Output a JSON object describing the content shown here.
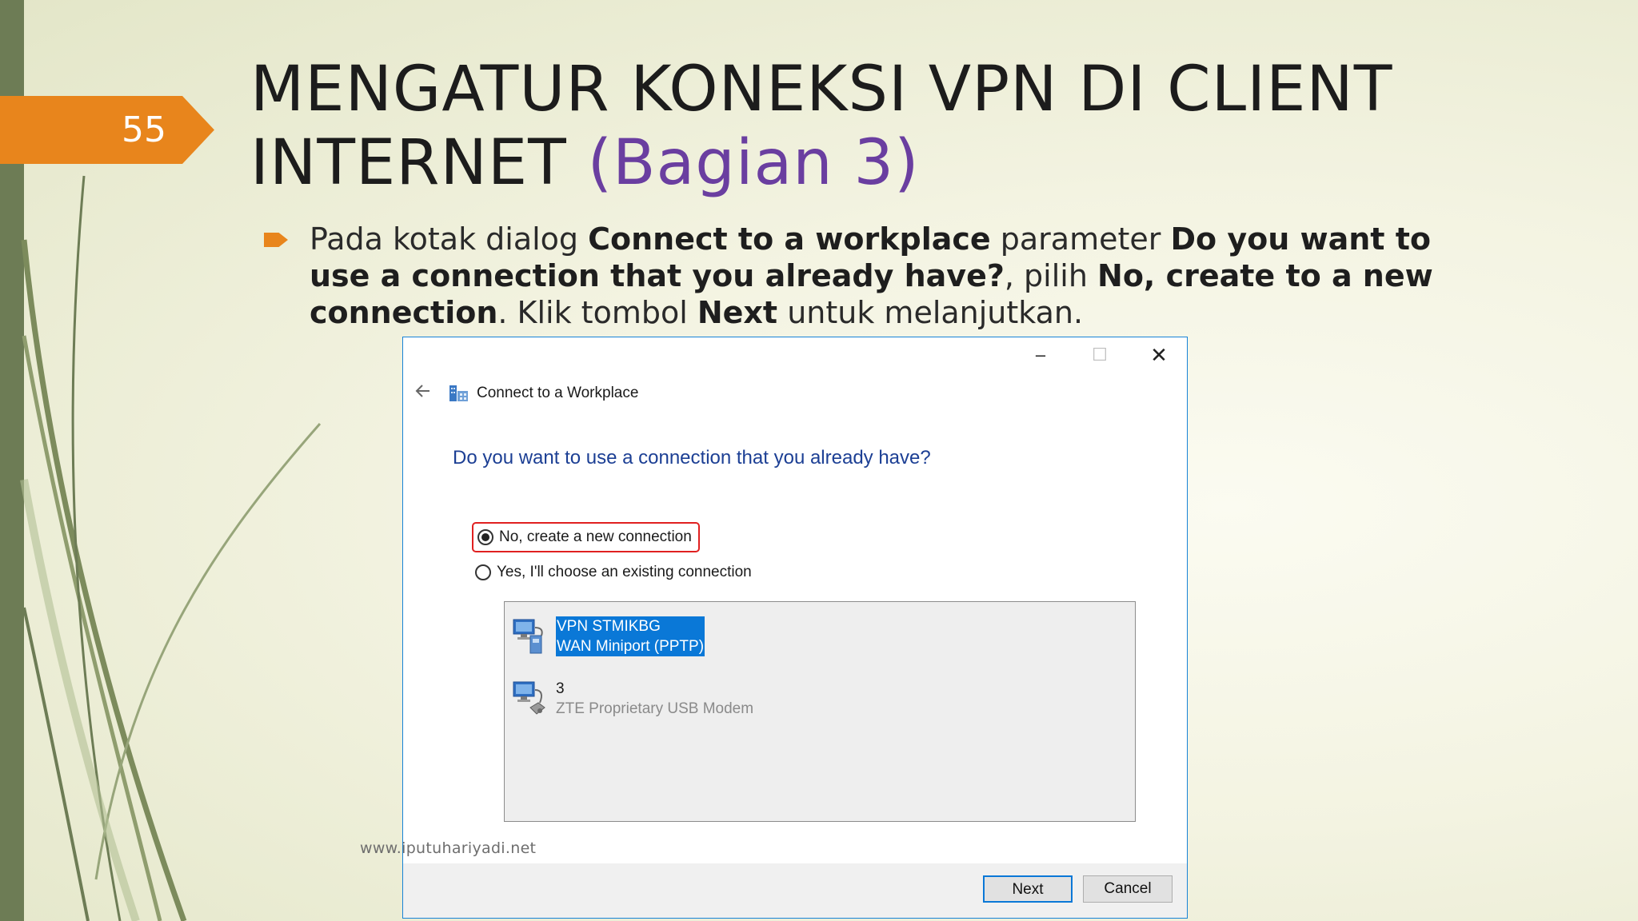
{
  "slide": {
    "page_number": "55",
    "title_main": "MENGATUR KONEKSI VPN DI CLIENT INTERNET",
    "title_accent": "(Bagian 3)",
    "bullet": {
      "t1": "Pada kotak dialog ",
      "b1": "Connect to a workplace",
      "t2": " parameter ",
      "b2": "Do you want to use a connection that you already have?",
      "t3": ", pilih ",
      "b3": "No, create to a new connection",
      "t4": ". Klik tombol ",
      "b4": "Next",
      "t5": " untuk melanjutkan."
    },
    "watermark": "www.iputuhariyadi.net",
    "colors": {
      "accent_orange": "#e8851c",
      "title_purple": "#6a3ea0",
      "sidebar_green": "#6d7c55"
    }
  },
  "dialog": {
    "window_controls": {
      "minimize": "–",
      "maximize": "☐",
      "close": "✕"
    },
    "back_icon": "back-arrow-icon",
    "title": "Connect to a Workplace",
    "question": "Do you want to use a connection that you already have?",
    "options": [
      {
        "label": "No, create a new connection",
        "selected": true
      },
      {
        "label": "Yes, I'll choose an existing connection",
        "selected": false
      }
    ],
    "connections": [
      {
        "name": "VPN STMIKBG",
        "device": "WAN Miniport (PPTP)",
        "selected": true,
        "icon": "vpn-network-icon"
      },
      {
        "name": "3",
        "device": "ZTE Proprietary USB Modem",
        "selected": false,
        "icon": "modem-network-icon"
      }
    ],
    "buttons": {
      "next": "Next",
      "cancel": "Cancel"
    },
    "colors": {
      "heading_blue": "#1c3f94",
      "selection_blue": "#0a78d7",
      "highlight_red": "#e02020"
    }
  }
}
